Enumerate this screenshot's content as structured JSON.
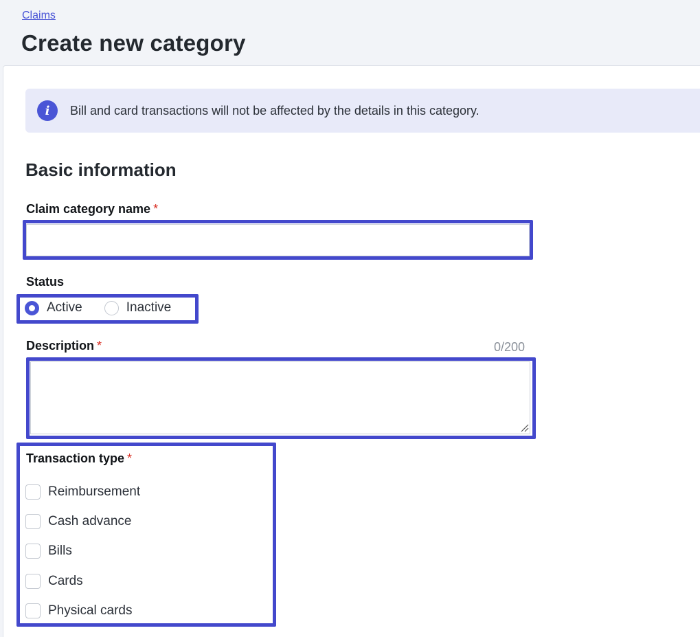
{
  "breadcrumb": {
    "label": "Claims"
  },
  "page": {
    "title": "Create new category"
  },
  "banner": {
    "icon": "info-icon",
    "text": "Bill and card transactions will not be affected by the details in this category."
  },
  "section": {
    "title": "Basic information"
  },
  "form": {
    "name": {
      "label": "Claim category name",
      "required_mark": "*",
      "value": "",
      "placeholder": ""
    },
    "status": {
      "label": "Status",
      "options": [
        {
          "label": "Active",
          "selected": true
        },
        {
          "label": "Inactive",
          "selected": false
        }
      ]
    },
    "description": {
      "label": "Description",
      "required_mark": "*",
      "counter": "0/200",
      "value": ""
    },
    "transaction_type": {
      "label": "Transaction type",
      "required_mark": "*",
      "options": [
        {
          "label": "Reimbursement",
          "checked": false
        },
        {
          "label": "Cash advance",
          "checked": false
        },
        {
          "label": "Bills",
          "checked": false
        },
        {
          "label": "Cards",
          "checked": false
        },
        {
          "label": "Physical cards",
          "checked": false
        }
      ]
    }
  },
  "colors": {
    "accent": "#4a55d6",
    "highlight": "#4348cc",
    "required": "#d93025",
    "banner_bg": "#e8eaf9"
  }
}
